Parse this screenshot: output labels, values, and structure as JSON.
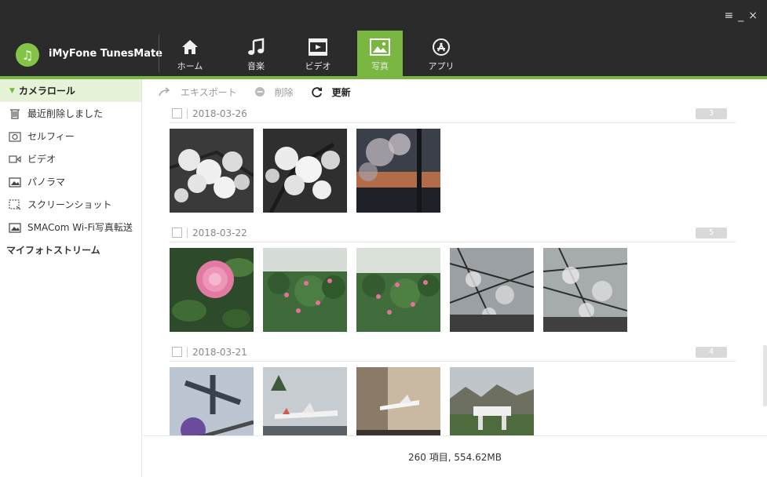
{
  "window": {
    "controls": [
      "≡",
      "_",
      "×"
    ]
  },
  "app": {
    "name": "iMyFone TunesMate"
  },
  "nav": [
    {
      "label": "ホーム",
      "icon": "home-icon",
      "active": false
    },
    {
      "label": "音楽",
      "icon": "music-icon",
      "active": false
    },
    {
      "label": "ビデオ",
      "icon": "video-icon",
      "active": false
    },
    {
      "label": "写真",
      "icon": "photo-icon",
      "active": true
    },
    {
      "label": "アプリ",
      "icon": "app-store-icon",
      "active": false
    }
  ],
  "sidebar": {
    "items": [
      {
        "label": "カメラロール",
        "icon": "caret-down-icon",
        "selected": true
      },
      {
        "label": "最近削除しました",
        "icon": "trash-icon"
      },
      {
        "label": "セルフィー",
        "icon": "selfie-icon"
      },
      {
        "label": "ビデオ",
        "icon": "video-icon"
      },
      {
        "label": "パノラマ",
        "icon": "panorama-icon"
      },
      {
        "label": "スクリーンショット",
        "icon": "screenshot-icon"
      },
      {
        "label": "SMACom Wi-Fi写真転送",
        "icon": "album-icon"
      },
      {
        "label": "マイフォトストリーム",
        "icon": ""
      }
    ]
  },
  "toolbar": {
    "export_label": "エキスポート",
    "delete_label": "削除",
    "refresh_label": "更新"
  },
  "groups": [
    {
      "date": "2018-03-26",
      "count": "3",
      "photos": [
        "white-blossom",
        "white-blossom",
        "sunset-tree"
      ]
    },
    {
      "date": "2018-03-22",
      "count": "5",
      "photos": [
        "pink-camellia",
        "camellia-bush",
        "camellia-bush",
        "bare-branches",
        "bare-branches"
      ]
    },
    {
      "date": "2018-03-21",
      "count": "4",
      "photos": [
        "aircraft-hall",
        "airplane-outdoor",
        "museum-room",
        "park-sign"
      ]
    }
  ],
  "status": {
    "summary": "260 項目, 554.62MB"
  },
  "colors": {
    "accent": "#7ab642",
    "header_bg": "#2b2b2b",
    "selected_bg": "#e6f3d9"
  }
}
